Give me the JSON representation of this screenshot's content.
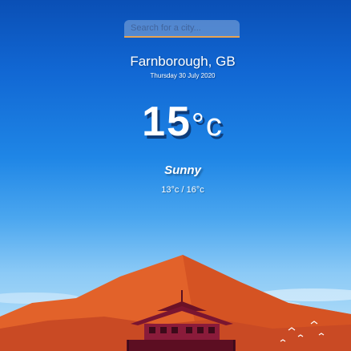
{
  "search": {
    "placeholder": "Search for a city...",
    "value": ""
  },
  "weather": {
    "location": "Farnborough, GB",
    "date": "Thursday 30 July 2020",
    "temperature": "15",
    "unit": "°c",
    "condition": "Sunny",
    "range": "13°c / 16°c"
  },
  "colors": {
    "sky_top": "#0a4fb5",
    "sky_bottom": "#bfe4f8",
    "mountain": "#e2622a",
    "search_underline": "#e8a451"
  },
  "icons": {
    "background": "mountain-lookout-illustration"
  }
}
